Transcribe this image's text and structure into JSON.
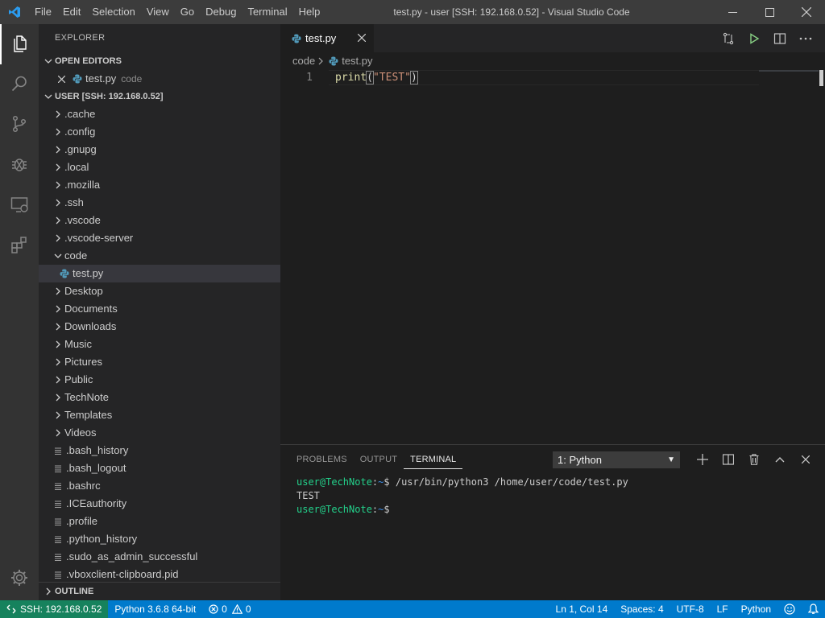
{
  "titlebar": {
    "menu": [
      "File",
      "Edit",
      "Selection",
      "View",
      "Go",
      "Debug",
      "Terminal",
      "Help"
    ],
    "title": "test.py - user [SSH: 192.168.0.52] - Visual Studio Code"
  },
  "activity_bar": {
    "items": [
      "files-icon",
      "search-icon",
      "source-control-icon",
      "debug-icon",
      "remote-explorer-icon",
      "extensions-icon"
    ],
    "bottom": "gear-icon"
  },
  "sidebar": {
    "title": "EXPLORER",
    "open_editors": {
      "header": "OPEN EDITORS",
      "items": [
        {
          "name": "test.py",
          "folder": "code"
        }
      ]
    },
    "workspace": {
      "header": "USER [SSH: 192.168.0.52]",
      "folders_top": [
        ".cache",
        ".config",
        ".gnupg",
        ".local",
        ".mozilla",
        ".ssh",
        ".vscode",
        ".vscode-server"
      ],
      "open_folder": "code",
      "open_folder_child": "test.py",
      "folders_bottom": [
        "Desktop",
        "Documents",
        "Downloads",
        "Music",
        "Pictures",
        "Public",
        "TechNote",
        "Templates",
        "Videos"
      ],
      "files": [
        ".bash_history",
        ".bash_logout",
        ".bashrc",
        ".ICEauthority",
        ".profile",
        ".python_history",
        ".sudo_as_admin_successful",
        ".vboxclient-clipboard.pid"
      ]
    },
    "outline": "OUTLINE"
  },
  "editor": {
    "tab": "test.py",
    "breadcrumb": [
      "code",
      "test.py"
    ],
    "line_number": "1",
    "code": {
      "fn": "print",
      "open": "(",
      "str": "\"TEST\"",
      "close": ")"
    }
  },
  "panel": {
    "tabs": [
      "PROBLEMS",
      "OUTPUT",
      "TERMINAL"
    ],
    "active_tab": "TERMINAL",
    "terminal_select": "1: Python",
    "lines": [
      {
        "user": "user@TechNote",
        "sep": ":",
        "path": "~",
        "cmd": "$ /usr/bin/python3 /home/user/code/test.py"
      },
      {
        "output": "TEST"
      },
      {
        "user": "user@TechNote",
        "sep": ":",
        "path": "~",
        "cmd": "$"
      }
    ]
  },
  "statusbar": {
    "remote": "SSH: 192.168.0.52",
    "python": "Python 3.6.8 64-bit",
    "errors": "0",
    "warnings": "0",
    "position": "Ln 1, Col 14",
    "spaces": "Spaces: 4",
    "encoding": "UTF-8",
    "eol": "LF",
    "language": "Python"
  },
  "colors": {
    "activity_bar": "#333333",
    "sidebar": "#252526",
    "editor": "#1e1e1e",
    "statusbar": "#007acc",
    "remote_indicator": "#16825d",
    "terminal_user": "#23d18b",
    "terminal_path": "#3b8eea"
  }
}
